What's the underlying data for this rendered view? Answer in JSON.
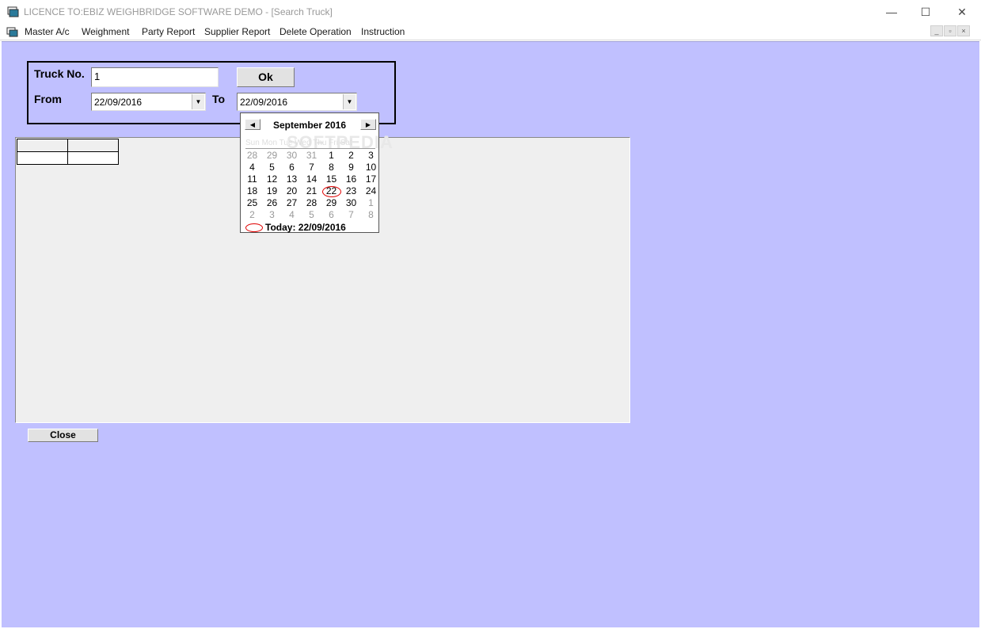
{
  "window": {
    "title": "LICENCE TO:EBIZ WEIGHBRIDGE SOFTWARE DEMO - [Search Truck]",
    "minimize_glyph": "—",
    "maximize_glyph": "☐",
    "close_glyph": "✕"
  },
  "menu": {
    "items": [
      "Master A/c",
      "Weighment",
      "Party Report",
      "Supplier Report",
      "Delete Operation",
      "Instruction"
    ],
    "mdi_glyphs": [
      "_",
      "▫",
      "×"
    ]
  },
  "form": {
    "truck_label": "Truck No.",
    "truck_value": "1",
    "ok_label": "Ok",
    "from_label": "From",
    "from_value": "22/09/2016",
    "to_label": "To",
    "to_value": "22/09/2016",
    "close_label": "Close",
    "dropdown_glyph": "▼"
  },
  "calendar": {
    "month_title": "September 2016",
    "prev_glyph": "◀",
    "next_glyph": "▶",
    "dow_header": "Sun  Mon  Tue  Wed  Thu  Fri  Sat",
    "watermark": "SOFTPEDIA",
    "days": [
      {
        "d": "28",
        "muted": true
      },
      {
        "d": "29",
        "muted": true
      },
      {
        "d": "30",
        "muted": true
      },
      {
        "d": "31",
        "muted": true
      },
      {
        "d": "1"
      },
      {
        "d": "2"
      },
      {
        "d": "3"
      },
      {
        "d": "4"
      },
      {
        "d": "5"
      },
      {
        "d": "6"
      },
      {
        "d": "7"
      },
      {
        "d": "8"
      },
      {
        "d": "9"
      },
      {
        "d": "10"
      },
      {
        "d": "11"
      },
      {
        "d": "12"
      },
      {
        "d": "13"
      },
      {
        "d": "14"
      },
      {
        "d": "15"
      },
      {
        "d": "16"
      },
      {
        "d": "17"
      },
      {
        "d": "18"
      },
      {
        "d": "19"
      },
      {
        "d": "20"
      },
      {
        "d": "21"
      },
      {
        "d": "22",
        "selected": true
      },
      {
        "d": "23"
      },
      {
        "d": "24"
      },
      {
        "d": "25"
      },
      {
        "d": "26"
      },
      {
        "d": "27"
      },
      {
        "d": "28"
      },
      {
        "d": "29"
      },
      {
        "d": "30"
      },
      {
        "d": "1",
        "muted": true
      },
      {
        "d": "2",
        "muted": true
      },
      {
        "d": "3",
        "muted": true
      },
      {
        "d": "4",
        "muted": true
      },
      {
        "d": "5",
        "muted": true
      },
      {
        "d": "6",
        "muted": true
      },
      {
        "d": "7",
        "muted": true
      },
      {
        "d": "8",
        "muted": true
      }
    ],
    "today_label": "Today: 22/09/2016"
  },
  "colors": {
    "client_background": "#c0c0ff",
    "grid_panel": "#efefef",
    "selection_ring": "#e00000"
  }
}
